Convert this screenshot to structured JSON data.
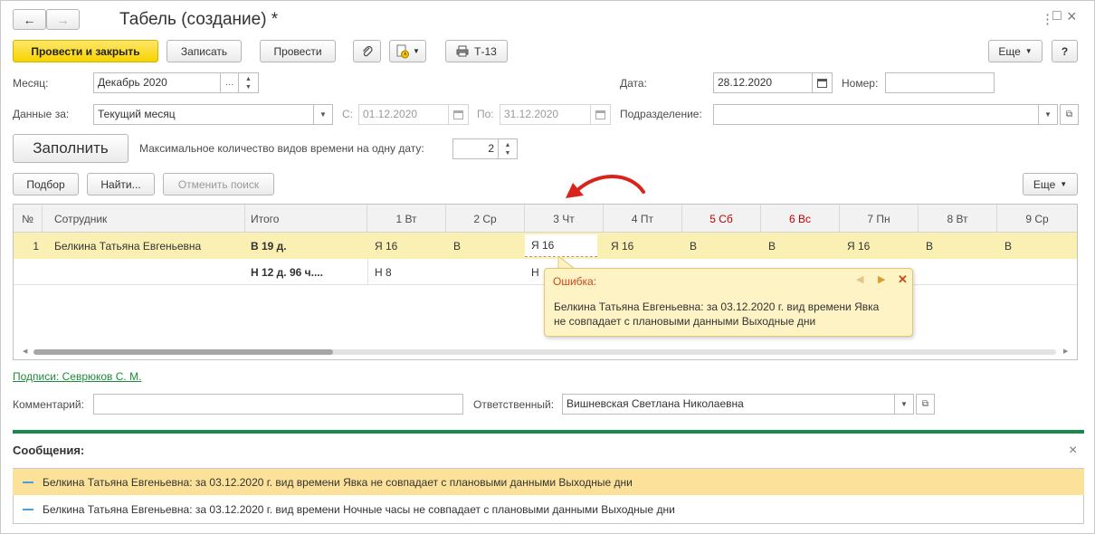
{
  "window": {
    "title": "Табель (создание) *",
    "back": "←",
    "forward": "→",
    "menu_icon": "⋮",
    "maximize_icon": "□",
    "close_icon": "×"
  },
  "toolbar": {
    "post_and_close": "Провести и закрыть",
    "save": "Записать",
    "post": "Провести",
    "t13": "Т-13",
    "more": "Еще",
    "help": "?"
  },
  "form": {
    "month_label": "Месяц:",
    "month_value": "Декабрь 2020",
    "date_label": "Дата:",
    "date_value": "28.12.2020",
    "number_label": "Номер:",
    "number_value": "",
    "data_for_label": "Данные за:",
    "data_for_value": "Текущий месяц",
    "from_label": "С:",
    "from_value": "01.12.2020",
    "to_label": "По:",
    "to_value": "31.12.2020",
    "department_label": "Подразделение:",
    "department_value": "",
    "fill_button": "Заполнить",
    "max_types_label": "Максимальное количество видов времени на одну дату:",
    "max_types_value": "2"
  },
  "grid_toolbar": {
    "select": "Подбор",
    "find": "Найти...",
    "cancel_search": "Отменить поиск",
    "more": "Еще"
  },
  "grid": {
    "headers": [
      "№",
      "Сотрудник",
      "Итого",
      "1 Вт",
      "2 Ср",
      "3 Чт",
      "4 Пт",
      "5 Сб",
      "6 Вс",
      "7 Пн",
      "8 Вт",
      "9 Ср"
    ],
    "row1": {
      "num": "1",
      "employee": "Белкина Татьяна Евгеньевна",
      "total": "В 19 д.",
      "days": [
        "Я 16",
        "В",
        "Я 16",
        "Я 16",
        "В",
        "В",
        "Я 16",
        "В",
        "В"
      ]
    },
    "row2": {
      "total": "Н 12 д. 96 ч....",
      "day1": "Н 8",
      "day3": "Н"
    }
  },
  "error_popup": {
    "title": "Ошибка:",
    "text_line1": "Белкина Татьяна Евгеньевна: за 03.12.2020 г. вид времени Явка",
    "text_line2": "не совпадает с плановыми данными Выходные дни",
    "prev_icon": "◀",
    "next_icon": "▶",
    "close_icon": "✕"
  },
  "signatures_link": "Подписи: Севрюков С. М.",
  "comment_label": "Комментарий:",
  "comment_value": "",
  "responsible_label": "Ответственный:",
  "responsible_value": "Вишневская Светлана Николаевна",
  "messages": {
    "title": "Сообщения:",
    "close_icon": "×",
    "items": [
      "Белкина Татьяна Евгеньевна: за 03.12.2020 г. вид времени Явка не совпадает с плановыми данными Выходные дни",
      "Белкина Татьяна Евгеньевна: за 03.12.2020 г. вид времени Ночные часы не совпадает с плановыми данными Выходные дни"
    ]
  },
  "colors": {
    "accent_yellow": "#f7d300",
    "selected_row": "#fbf0b4",
    "weekend_red": "#c00000",
    "divider_green": "#1a8a4a",
    "link_green": "#1e8a3a",
    "arrow_red": "#d9241b"
  }
}
